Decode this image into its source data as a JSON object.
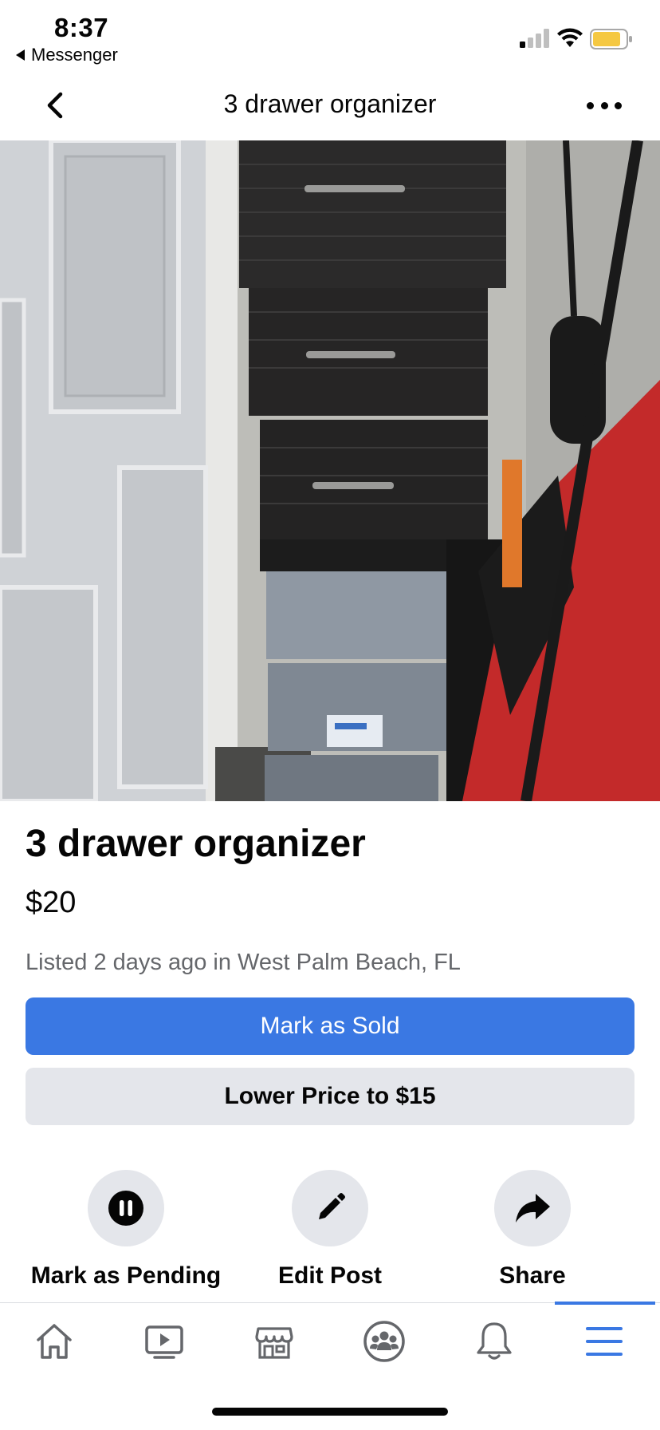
{
  "status_bar": {
    "time": "8:37",
    "back_app_label": "Messenger",
    "icons": [
      "signal-icon",
      "wifi-icon",
      "battery-icon"
    ]
  },
  "nav": {
    "title": "3 drawer organizer",
    "back_icon": "chevron-left-icon",
    "more_icon": "more-icon"
  },
  "listing": {
    "title": "3 drawer organizer",
    "price": "$20",
    "meta": "Listed 2 days ago in West Palm Beach, FL",
    "primary_button": "Mark as Sold",
    "secondary_button": "Lower Price to $15"
  },
  "actions": [
    {
      "label": "Mark as Pending",
      "icon": "pause-icon"
    },
    {
      "label": "Edit Post",
      "icon": "pencil-icon"
    },
    {
      "label": "Share",
      "icon": "share-arrow-icon"
    }
  ],
  "tab_bar": {
    "tabs": [
      "home-icon",
      "watch-icon",
      "marketplace-icon",
      "groups-icon",
      "notifications-icon",
      "menu-icon"
    ],
    "active": "menu-icon"
  },
  "colors": {
    "accent": "#3a78e3",
    "secondary_button": "#e4e6eb",
    "meta_text": "#65676b",
    "battery": "#f5c842"
  }
}
